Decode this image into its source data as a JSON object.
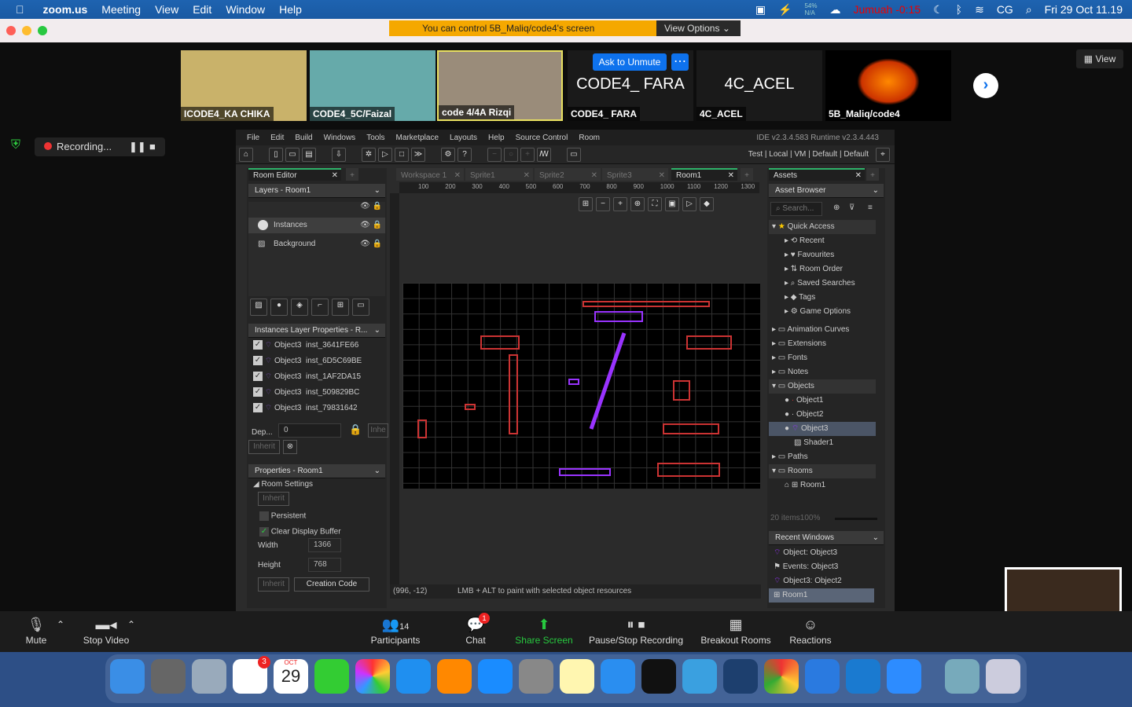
{
  "menubar": {
    "app": "zoom.us",
    "items": [
      "Meeting",
      "View",
      "Edit",
      "Window",
      "Help"
    ],
    "battery_pct": "54%",
    "battery_na": "N/A",
    "prayer": "Jumuah -0:15",
    "user": "CG",
    "datetime": "Fri 29 Oct  11.19"
  },
  "zoom": {
    "banner": "You can control 5B_Maliq/code4's screen",
    "view_options": "View Options",
    "view_button": "View",
    "recording": "Recording...",
    "participants": [
      {
        "name": "ICODE4_KA CHIKA"
      },
      {
        "name": "CODE4_5C/Faizal"
      },
      {
        "name": "code 4/4A Rizqi"
      },
      {
        "name": "CODE4_ FARA",
        "big": "CODE4_ FARA",
        "ask_unmute": "Ask to Unmute"
      },
      {
        "name": "4C_ACEL",
        "big": "4C_ACEL"
      },
      {
        "name": "5B_Maliq/code4"
      }
    ],
    "toolbar": {
      "mute": "Mute",
      "stop_video": "Stop Video",
      "participants": "Participants",
      "participant_count": "14",
      "chat": "Chat",
      "chat_badge": "1",
      "share": "Share Screen",
      "pause_rec": "Pause/Stop Recording",
      "breakout": "Breakout Rooms",
      "reactions": "Reactions"
    }
  },
  "gm": {
    "menu": [
      "File",
      "Edit",
      "Build",
      "Windows",
      "Tools",
      "Marketplace",
      "Layouts",
      "Help",
      "Source Control",
      "Room"
    ],
    "version": "IDE v2.3.4.583  Runtime v2.3.4.443",
    "target": "Test | Local | VM | Default | Default",
    "left_tab": "Room Editor",
    "layers_hdr": "Layers - Room1",
    "layers": [
      "Instances",
      "Background"
    ],
    "inst_hdr": "Instances Layer Properties - R...",
    "instances": [
      [
        "Object3",
        "inst_3641FE66"
      ],
      [
        "Object3",
        "inst_6D5C69BE"
      ],
      [
        "Object3",
        "inst_1AF2DA15"
      ],
      [
        "Object3",
        "inst_509829BC"
      ],
      [
        "Object3",
        "inst_79831642"
      ]
    ],
    "depth_label": "Dep...",
    "depth_value": "0",
    "inherit": "Inherit",
    "inherit_short": "Inhe",
    "props_hdr": "Properties - Room1",
    "room_settings": "Room Settings",
    "persistent": "Persistent",
    "clear_display": "Clear Display Buffer",
    "width_label": "Width",
    "width_value": "1366",
    "height_label": "Height",
    "height_value": "768",
    "creation_code": "Creation Code",
    "doc_tabs": [
      "Workspace 1",
      "Sprite1",
      "Sprite2",
      "Sprite3",
      "Room1"
    ],
    "ruler": [
      "100",
      "200",
      "300",
      "400",
      "500",
      "600",
      "700",
      "800",
      "900",
      "1000",
      "1100",
      "1200",
      "1300"
    ],
    "status_coords": "(996, -12)",
    "status_msg": "LMB + ALT to paint with selected object resources",
    "assets_tab": "Assets",
    "asset_browser": "Asset Browser",
    "search_placeholder": "Search...",
    "quick_access": "Quick Access",
    "qa_items": [
      "Recent",
      "Favourites",
      "Room Order",
      "Saved Searches",
      "Tags",
      "Game Options"
    ],
    "groups": [
      "Animation Curves",
      "Extensions",
      "Fonts",
      "Notes",
      "Objects"
    ],
    "objects": [
      "Object1",
      "Object2",
      "Object3",
      "Shader1"
    ],
    "groups2": [
      "Paths",
      "Rooms"
    ],
    "rooms": [
      "Room1"
    ],
    "items_count": "20 items",
    "zoom_pct": "100%",
    "recent_hdr": "Recent Windows",
    "recent": [
      "Object: Object3",
      "Events: Object3",
      "Object3: Object2",
      "Room1"
    ]
  },
  "dock": {
    "calendar_month": "OCT",
    "calendar_day": "29",
    "reminders_badge": "3"
  }
}
